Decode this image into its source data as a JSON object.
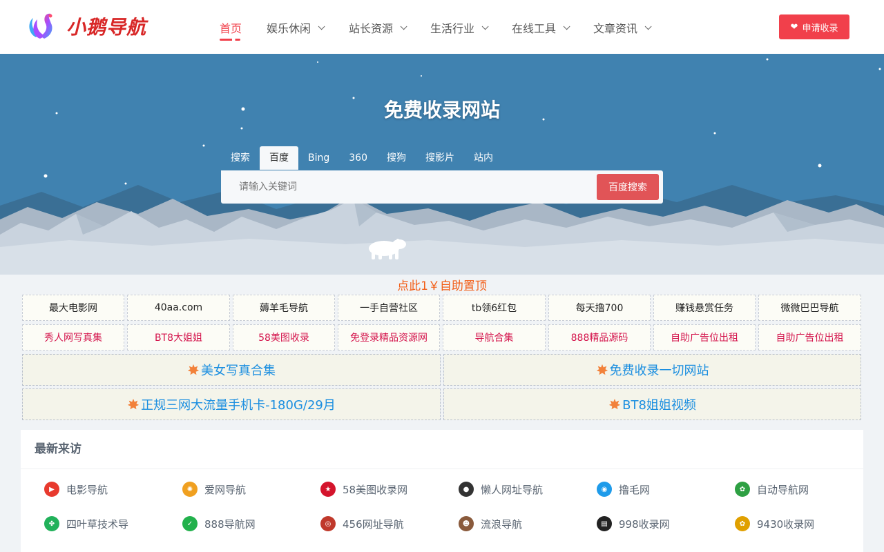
{
  "header": {
    "logo_text": "小鹅导航",
    "nav": [
      {
        "label": "首页",
        "active": true,
        "dropdown": false
      },
      {
        "label": "娱乐休闲",
        "active": false,
        "dropdown": true
      },
      {
        "label": "站长资源",
        "active": false,
        "dropdown": true
      },
      {
        "label": "生活行业",
        "active": false,
        "dropdown": true
      },
      {
        "label": "在线工具",
        "active": false,
        "dropdown": true
      },
      {
        "label": "文章资讯",
        "active": false,
        "dropdown": true
      }
    ],
    "apply_button": "申请收录"
  },
  "hero": {
    "title": "免费收录网站",
    "engine_tabs": [
      "搜索",
      "百度",
      "Bing",
      "360",
      "搜狗",
      "搜影片",
      "站内"
    ],
    "active_tab": "百度",
    "search_placeholder": "请输入关键词",
    "search_button": "百度搜索"
  },
  "promo": {
    "title": "点此1￥自助置顶",
    "row1": [
      "最大电影网",
      "40aa.com",
      "薅羊毛导航",
      "一手自营社区",
      "tb领6红包",
      "每天撸700",
      "赚钱悬赏任务",
      "微微巴巴导航"
    ],
    "row2": [
      "秀人网写真集",
      "BT8大姐姐",
      "58美图收录",
      "免登录精品资源网",
      "导航合集",
      "888精品源码",
      "自助广告位出租",
      "自助广告位出租"
    ],
    "big": [
      "美女写真合集",
      "免费收录一切网站",
      "正规三网大流量手机卡-180G/29月",
      "BT8姐姐视频"
    ]
  },
  "visitors": {
    "title": "最新来访",
    "items": [
      {
        "label": "电影导航",
        "icon": "play-icon",
        "color": "#e83a2e"
      },
      {
        "label": "爱网导航",
        "icon": "pinwheel-icon",
        "color": "#f0a020"
      },
      {
        "label": "58美图收录网",
        "icon": "star-icon",
        "color": "#d4142c"
      },
      {
        "label": "懒人网址导航",
        "icon": "penguin-icon",
        "color": "#333333"
      },
      {
        "label": "撸毛网",
        "icon": "circle-logo-icon",
        "color": "#1e9bea"
      },
      {
        "label": "自动导航网",
        "icon": "colorful-circle-icon",
        "color": "#2ea043"
      },
      {
        "label": "四叶草技术导",
        "icon": "clover-icon",
        "color": "#21b15a"
      },
      {
        "label": "888导航网",
        "icon": "check-icon",
        "color": "#22b14c"
      },
      {
        "label": "456网址导航",
        "icon": "badge-icon",
        "color": "#c0392b"
      },
      {
        "label": "流浪导航",
        "icon": "avatar-icon",
        "color": "#8a5a3c"
      },
      {
        "label": "998收录网",
        "icon": "text-logo-icon",
        "color": "#222222"
      },
      {
        "label": "9430收录网",
        "icon": "colorful-circle-icon",
        "color": "#e0a000"
      }
    ]
  },
  "colors": {
    "brand": "#f1404b",
    "hero_bg": "#4082b0",
    "promo_orange": "#f25d16",
    "promo_red": "#d4144c",
    "link_blue": "#1a8ee0"
  }
}
